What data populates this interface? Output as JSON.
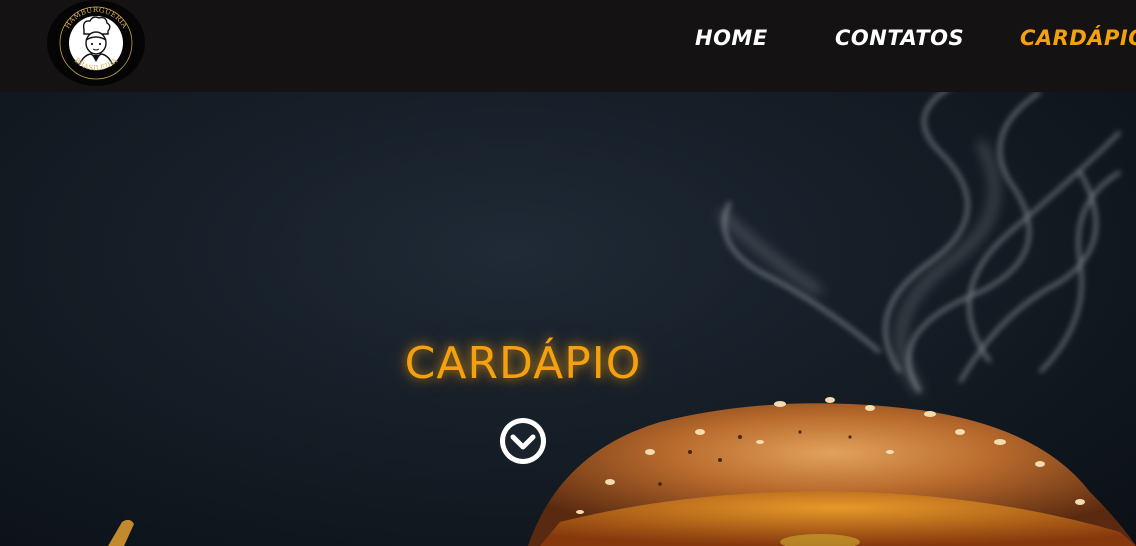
{
  "logo": {
    "text_top": "HAMBURGUERIA",
    "text_bottom": "BRASILEIRA",
    "icon": "chef-icon"
  },
  "nav": {
    "items": [
      {
        "label": "HOME",
        "active": false
      },
      {
        "label": "CONTATOS",
        "active": false
      },
      {
        "label": "CARDÁPIO",
        "active": true
      }
    ]
  },
  "hero": {
    "title": "CARDÁPIO",
    "scroll_icon": "chevron-down-circle-icon"
  },
  "colors": {
    "accent": "#f5a10f",
    "navbar": "#141212",
    "text": "#ffffff"
  }
}
